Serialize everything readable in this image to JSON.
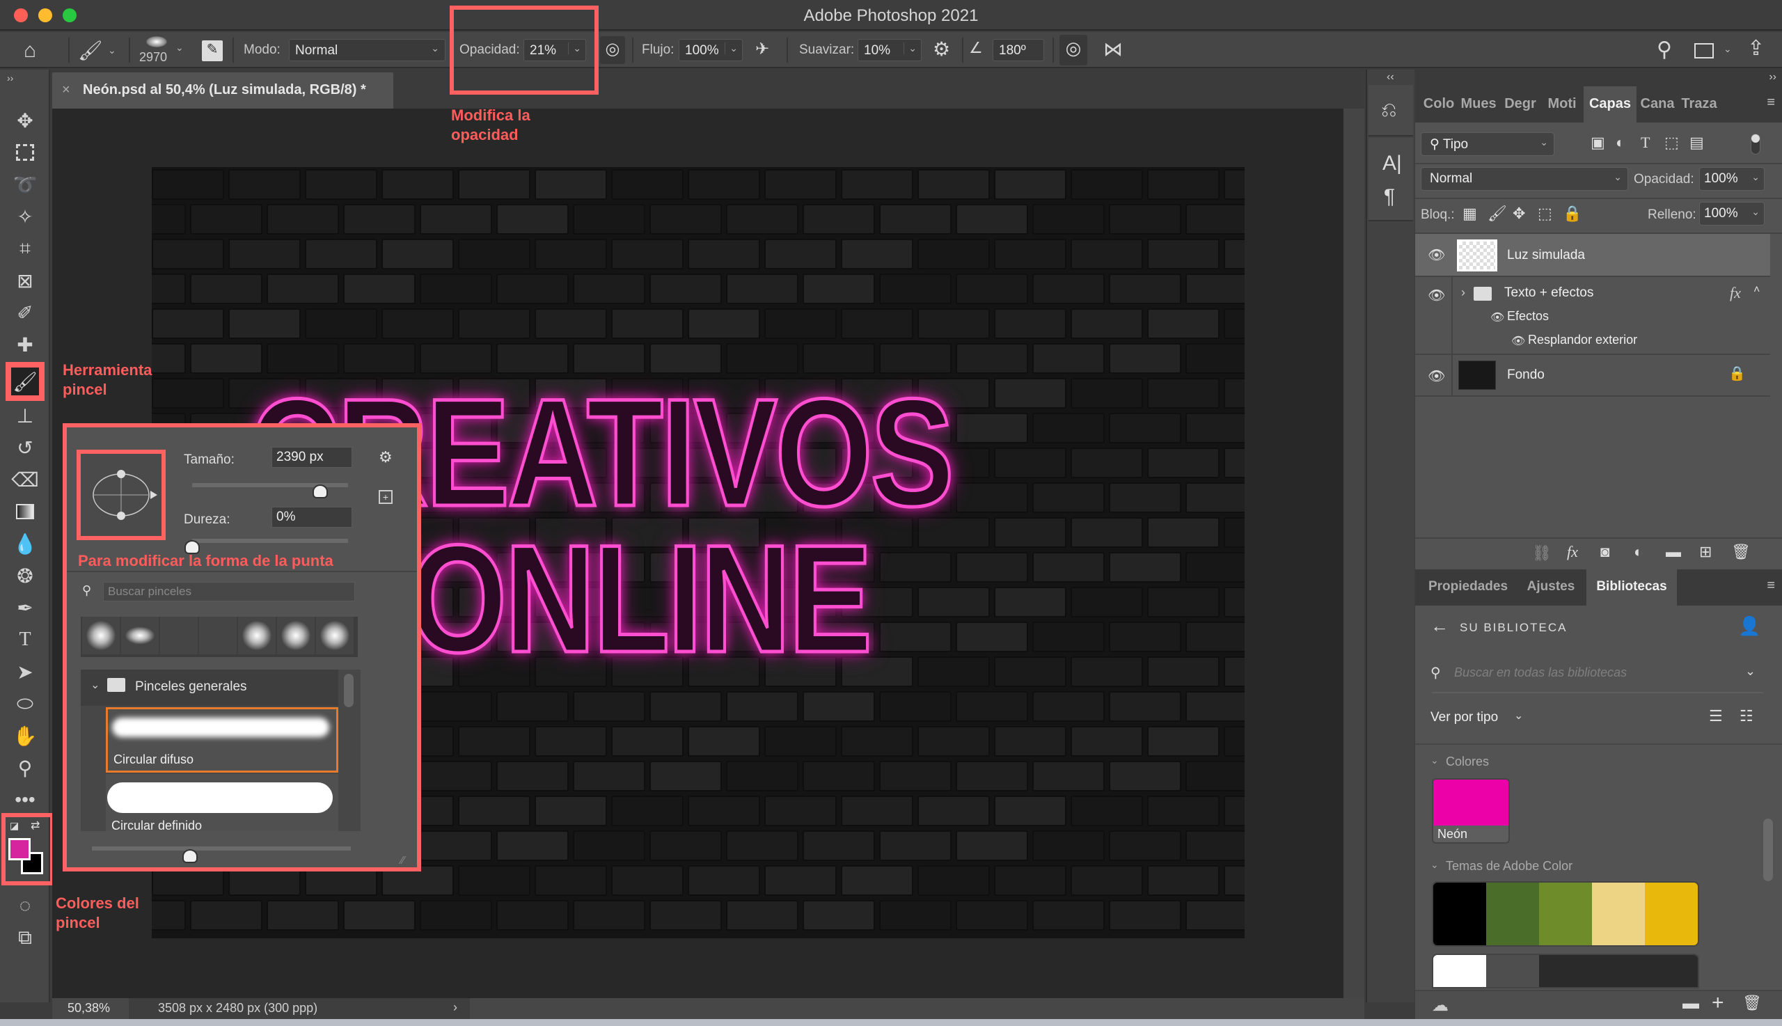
{
  "window": {
    "title": "Adobe Photoshop 2021",
    "traffic_lights": {
      "close": "#ff5f57",
      "minimize": "#febc2e",
      "zoom": "#28c840"
    }
  },
  "options_bar": {
    "home_icon": "home-icon",
    "brush_size_value": "2970",
    "mode_label": "Modo:",
    "mode_value": "Normal",
    "opacity_label": "Opacidad:",
    "opacity_value": "21%",
    "flow_label": "Flujo:",
    "flow_value": "100%",
    "smoothing_label": "Suavizar:",
    "smoothing_value": "10%",
    "angle_value": "180º"
  },
  "document_tab": {
    "close": "×",
    "title": "Neón.psd al 50,4% (Luz simulada, RGB/8) *"
  },
  "toolbar": {
    "expand": "››",
    "tools": [
      "move",
      "marquee",
      "lasso",
      "magic-wand",
      "crop",
      "frame",
      "eyedropper",
      "healing",
      "brush",
      "stamp",
      "history-brush",
      "eraser",
      "gradient",
      "blur",
      "sponge",
      "pen",
      "type",
      "path-select",
      "ellipse",
      "hand",
      "zoom",
      "more"
    ],
    "active_tool": "brush",
    "foreground_color": "#d6249e",
    "background_color": "#000000"
  },
  "canvas": {
    "line1": "CREATIVOS",
    "line2": "ONLINE",
    "neon_color": "#ff4fd0"
  },
  "annotations": {
    "opacity": "Modifica la opacidad",
    "opacity_l1": "Modifica la",
    "opacity_l2": "opacidad",
    "brush_tool_l1": "Herramienta",
    "brush_tool_l2": "pincel",
    "brush_tip": "Para modificar la forma de la punta",
    "colors_l1": "Colores del",
    "colors_l2": "pincel",
    "color": "#ff6060"
  },
  "brush_popup": {
    "size_label": "Tamaño:",
    "size_value": "2390 px",
    "size_slider_percent": 82,
    "hardness_label": "Dureza:",
    "hardness_value": "0%",
    "hardness_slider_percent": 0,
    "search_placeholder": "Buscar pinceles",
    "folder_name": "Pinceles generales",
    "brushes": [
      "Circular difuso",
      "Circular definido"
    ],
    "selected_brush": "Circular difuso",
    "preview_slider_percent": 38
  },
  "status_bar": {
    "zoom": "50,38%",
    "doc_info": "3508 px x 2480 px (300 ppp)",
    "arrow": "›"
  },
  "right_strip": {
    "collapse": "‹‹",
    "expand": "››"
  },
  "layers_panel": {
    "tabs": [
      "Colo",
      "Mues",
      "Degr",
      "Moti",
      "Capas",
      "Cana",
      "Traza"
    ],
    "active_tab": "Capas",
    "filter_value": "Tipo",
    "blend_mode": "Normal",
    "opacity_label": "Opacidad:",
    "opacity_value": "100%",
    "lock_label": "Bloq.:",
    "fill_label": "Relleno:",
    "fill_value": "100%",
    "layers": [
      {
        "name": "Luz simulada",
        "selected": true
      },
      {
        "name": "Texto + efectos",
        "group": true,
        "fx": "fx"
      },
      {
        "name": "Efectos",
        "sub": true
      },
      {
        "name": "Resplandor exterior",
        "sub": true
      },
      {
        "name": "Fondo",
        "locked": true
      }
    ]
  },
  "libraries_panel": {
    "tabs": [
      "Propiedades",
      "Ajustes",
      "Bibliotecas"
    ],
    "active_tab": "Bibliotecas",
    "header": "SU BIBLIOTECA",
    "search_placeholder": "Buscar en todas las bibliotecas",
    "view_by": "Ver por tipo",
    "colors_section": "Colores",
    "color_swatch": {
      "name": "Neón",
      "hex": "#ec00a8"
    },
    "themes_section": "Temas de Adobe Color",
    "theme1": [
      "#000000",
      "#4a6e2a",
      "#6e8c2a",
      "#ecd484",
      "#e8b80c"
    ],
    "theme2": [
      "#ffffff",
      "#4e4e4e",
      "#2a2a2a"
    ]
  }
}
